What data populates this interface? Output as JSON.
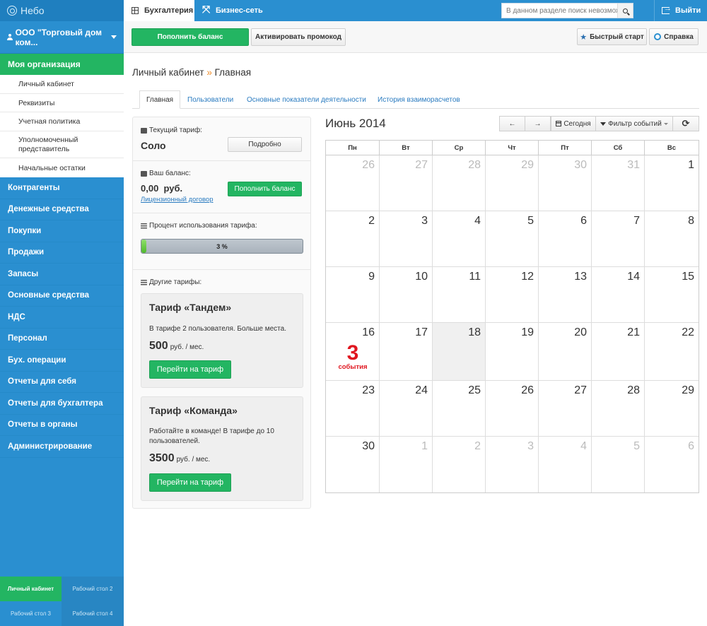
{
  "app": {
    "logo": "Небо"
  },
  "org": {
    "name": "ООО \"Торговый дом ком..."
  },
  "sidebar": {
    "active": "Моя организация",
    "subitems": [
      "Личный кабинет",
      "Реквизиты",
      "Учетная политика",
      "Уполномоченный представитель",
      "Начальные остатки"
    ],
    "items": [
      "Контрагенты",
      "Денежные средства",
      "Покупки",
      "Продажи",
      "Запасы",
      "Основные средства",
      "НДС",
      "Персонал",
      "Бух. операции",
      "Отчеты для себя",
      "Отчеты для бухгалтера",
      "Отчеты в органы",
      "Администрирование"
    ],
    "tiles": [
      "Личный кабинет",
      "Рабочий стол 2",
      "Рабочий стол 3",
      "Рабочий стол 4"
    ]
  },
  "topbar": {
    "tab_accounting": "Бухгалтерия",
    "tab_network": "Бизнес-сеть",
    "search_placeholder": "В данном разделе поиск невозможен",
    "logout": "Выйти"
  },
  "actions": {
    "top_up": "Пополнить баланс",
    "promo": "Активировать промокод",
    "quick_start": "Быстрый старт",
    "help": "Справка"
  },
  "breadcrumb": {
    "parent": "Личный кабинет",
    "sep": "»",
    "current": "Главная"
  },
  "tabs": [
    "Главная",
    "Пользователи",
    "Основные показатели деятельности",
    "История взаиморасчетов"
  ],
  "account": {
    "tariff_label": "Текущий тариф:",
    "tariff_name": "Соло",
    "details_btn": "Подробно",
    "balance_label": "Ваш баланс:",
    "balance_value": "0,00  руб.",
    "top_up_btn": "Пополнить баланс",
    "license_link": "Лицензионный договор",
    "usage_label": "Процент использования тарифа:",
    "usage_percent": 3,
    "usage_text": "3 %",
    "other_label": "Другие тарифы:"
  },
  "plans": [
    {
      "title": "Тариф «Тандем»",
      "desc": "В тарифе 2 пользователя. Больше места.",
      "price": "500",
      "unit": "руб. / мес.",
      "button": "Перейти на тариф"
    },
    {
      "title": "Тариф «Команда»",
      "desc": "Работайте в команде! В тарифе до 10 пользователей.",
      "price": "3500",
      "unit": "руб. / мес.",
      "button": "Перейти на тариф"
    }
  ],
  "calendar": {
    "title": "Июнь 2014",
    "prev": "←",
    "next": "→",
    "today_btn": "Сегодня",
    "filter_btn": "Фильтр событий",
    "refresh": "⟳",
    "weekdays": [
      "Пн",
      "Вт",
      "Ср",
      "Чт",
      "Пт",
      "Сб",
      "Вс"
    ],
    "weeks": [
      [
        {
          "d": "26",
          "o": true
        },
        {
          "d": "27",
          "o": true
        },
        {
          "d": "28",
          "o": true
        },
        {
          "d": "29",
          "o": true
        },
        {
          "d": "30",
          "o": true
        },
        {
          "d": "31",
          "o": true
        },
        {
          "d": "1"
        }
      ],
      [
        {
          "d": "2"
        },
        {
          "d": "3"
        },
        {
          "d": "4"
        },
        {
          "d": "5"
        },
        {
          "d": "6"
        },
        {
          "d": "7"
        },
        {
          "d": "8"
        }
      ],
      [
        {
          "d": "9"
        },
        {
          "d": "10"
        },
        {
          "d": "11"
        },
        {
          "d": "12"
        },
        {
          "d": "13"
        },
        {
          "d": "14"
        },
        {
          "d": "15"
        }
      ],
      [
        {
          "d": "16",
          "ev": "3",
          "evl": "события"
        },
        {
          "d": "17"
        },
        {
          "d": "18",
          "today": true
        },
        {
          "d": "19"
        },
        {
          "d": "20"
        },
        {
          "d": "21"
        },
        {
          "d": "22"
        }
      ],
      [
        {
          "d": "23"
        },
        {
          "d": "24"
        },
        {
          "d": "25"
        },
        {
          "d": "26"
        },
        {
          "d": "27"
        },
        {
          "d": "28"
        },
        {
          "d": "29"
        }
      ],
      [
        {
          "d": "30"
        },
        {
          "d": "1",
          "o": true
        },
        {
          "d": "2",
          "o": true
        },
        {
          "d": "3",
          "o": true
        },
        {
          "d": "4",
          "o": true
        },
        {
          "d": "5",
          "o": true
        },
        {
          "d": "6",
          "o": true
        }
      ]
    ]
  }
}
